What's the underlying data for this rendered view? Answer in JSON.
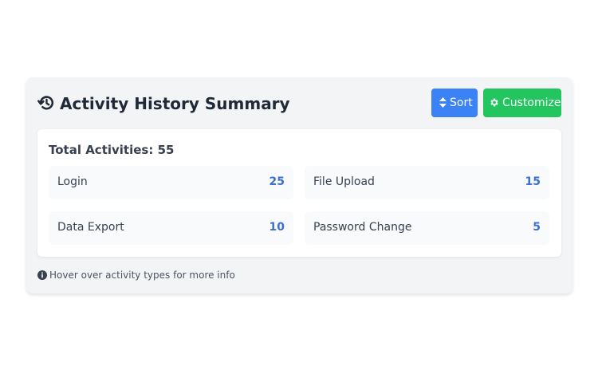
{
  "header": {
    "title": "Activity History Summary",
    "title_icon": "history-icon",
    "sort_label": "Sort",
    "sort_icon": "sort-icon",
    "customize_label": "Customize",
    "customize_icon": "gear-icon"
  },
  "summary": {
    "total_text": "Total Activities: 55",
    "items": [
      {
        "label": "Login",
        "value": "25"
      },
      {
        "label": "File Upload",
        "value": "15"
      },
      {
        "label": "Data Export",
        "value": "10"
      },
      {
        "label": "Password Change",
        "value": "5"
      }
    ]
  },
  "footer": {
    "hint": "Hover over activity types for more info",
    "hint_icon": "info-icon"
  },
  "colors": {
    "sort_button": "#3b82f6",
    "customize_button": "#22c55e",
    "value_text": "#3b6fd4",
    "card_background": "#f3f4f6"
  }
}
